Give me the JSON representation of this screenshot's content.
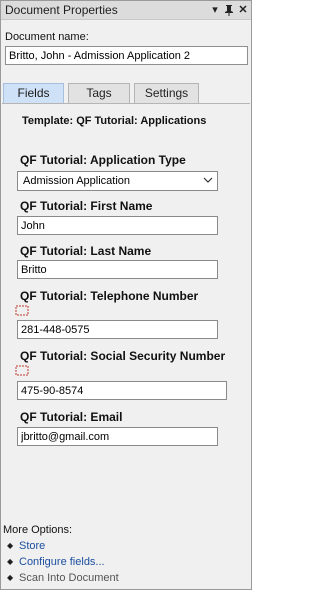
{
  "window": {
    "title": "Document Properties",
    "menu_glyph": "▾",
    "pin_glyph": "ꝗ",
    "close_glyph": "✕"
  },
  "document": {
    "name_label": "Document name:",
    "name_value": "Britto, John - Admission Application 2"
  },
  "tabs": [
    {
      "label": "Fields",
      "active": true
    },
    {
      "label": "Tags",
      "active": false
    },
    {
      "label": "Settings",
      "active": false
    }
  ],
  "fields_tab": {
    "template_label": "Template: QF Tutorial: Applications",
    "fields": [
      {
        "label": "QF Tutorial: Application Type",
        "type": "select",
        "value": "Admission Application"
      },
      {
        "label": "QF Tutorial: First Name",
        "type": "text",
        "value": "John"
      },
      {
        "label": "QF Tutorial: Last Name",
        "type": "text",
        "value": "Britto"
      },
      {
        "label": "QF Tutorial: Telephone Number",
        "type": "text",
        "value": "281-448-0575"
      },
      {
        "label": "QF Tutorial: Social Security Number",
        "type": "text",
        "value": "475-90-8574"
      },
      {
        "label": "QF Tutorial: Email",
        "type": "text",
        "value": "jbritto@gmail.com"
      }
    ]
  },
  "more_options": {
    "label": "More Options:",
    "items": [
      {
        "label": "Store",
        "enabled": true
      },
      {
        "label": "Configure fields...",
        "enabled": true
      },
      {
        "label": "Scan Into Document",
        "enabled": false
      }
    ]
  },
  "colors": {
    "active_tab": "#cfe1f6",
    "link": "#1c4fa0",
    "panel_bg": "#f0f0f0"
  }
}
